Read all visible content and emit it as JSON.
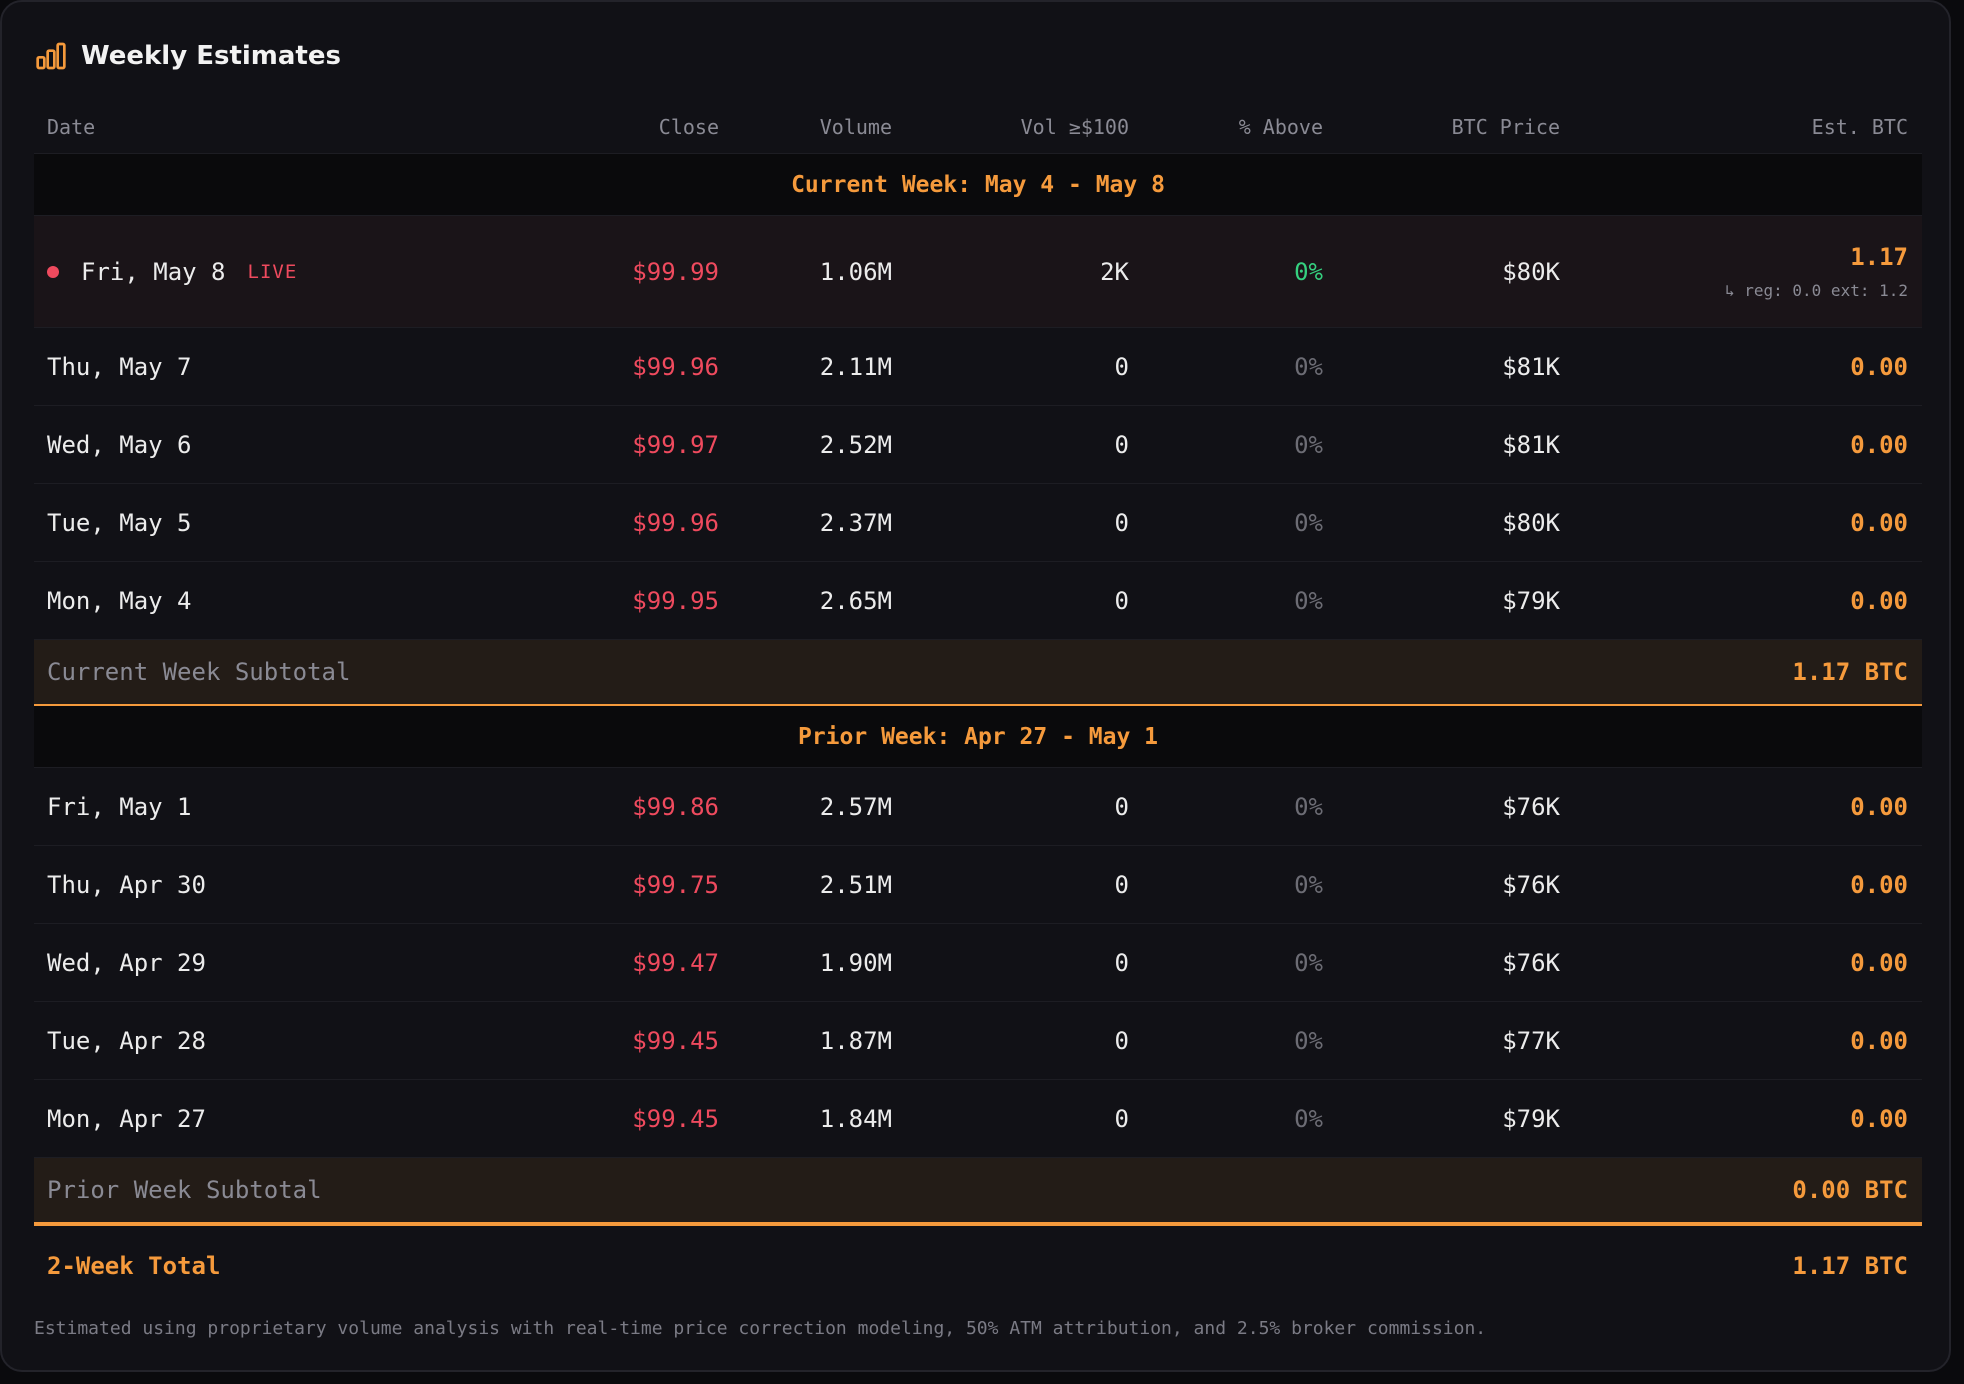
{
  "panel": {
    "title": "Weekly Estimates",
    "icon": "bar-chart-icon"
  },
  "columns": {
    "date": "Date",
    "close": "Close",
    "volume": "Volume",
    "vol100": "Vol ≥$100",
    "pct_above": "% Above",
    "btc_price": "BTC Price",
    "est_btc": "Est. BTC"
  },
  "current_week": {
    "heading": "Current Week: May 4 - May 8",
    "live": {
      "date": "Fri, May 8",
      "badge": "LIVE",
      "close": "$99.99",
      "volume": "1.06M",
      "vol100": "2K",
      "pct_above": "0%",
      "btc_price": "$80K",
      "est_btc": "1.17",
      "est_detail": "↳ reg: 0.0 ext: 1.2"
    },
    "rows": [
      {
        "date": "Thu, May 7",
        "close": "$99.96",
        "volume": "2.11M",
        "vol100": "0",
        "pct_above": "0%",
        "btc_price": "$81K",
        "est_btc": "0.00"
      },
      {
        "date": "Wed, May 6",
        "close": "$99.97",
        "volume": "2.52M",
        "vol100": "0",
        "pct_above": "0%",
        "btc_price": "$81K",
        "est_btc": "0.00"
      },
      {
        "date": "Tue, May 5",
        "close": "$99.96",
        "volume": "2.37M",
        "vol100": "0",
        "pct_above": "0%",
        "btc_price": "$80K",
        "est_btc": "0.00"
      },
      {
        "date": "Mon, May 4",
        "close": "$99.95",
        "volume": "2.65M",
        "vol100": "0",
        "pct_above": "0%",
        "btc_price": "$79K",
        "est_btc": "0.00"
      }
    ],
    "subtotal_label": "Current Week Subtotal",
    "subtotal_value": "1.17 BTC"
  },
  "prior_week": {
    "heading": "Prior Week: Apr 27 - May 1",
    "rows": [
      {
        "date": "Fri, May 1",
        "close": "$99.86",
        "volume": "2.57M",
        "vol100": "0",
        "pct_above": "0%",
        "btc_price": "$76K",
        "est_btc": "0.00"
      },
      {
        "date": "Thu, Apr 30",
        "close": "$99.75",
        "volume": "2.51M",
        "vol100": "0",
        "pct_above": "0%",
        "btc_price": "$76K",
        "est_btc": "0.00"
      },
      {
        "date": "Wed, Apr 29",
        "close": "$99.47",
        "volume": "1.90M",
        "vol100": "0",
        "pct_above": "0%",
        "btc_price": "$76K",
        "est_btc": "0.00"
      },
      {
        "date": "Tue, Apr 28",
        "close": "$99.45",
        "volume": "1.87M",
        "vol100": "0",
        "pct_above": "0%",
        "btc_price": "$77K",
        "est_btc": "0.00"
      },
      {
        "date": "Mon, Apr 27",
        "close": "$99.45",
        "volume": "1.84M",
        "vol100": "0",
        "pct_above": "0%",
        "btc_price": "$79K",
        "est_btc": "0.00"
      }
    ],
    "subtotal_label": "Prior Week Subtotal",
    "subtotal_value": "0.00 BTC"
  },
  "total": {
    "label": "2-Week Total",
    "value": "1.17 BTC"
  },
  "footnote": "Estimated using proprietary volume analysis with real-time price correction modeling, 50% ATM attribution, and 2.5% broker commission.",
  "colors": {
    "accent": "#f59a3c",
    "negative": "#ef4a5e",
    "positive": "#35d07f",
    "background": "#111116"
  }
}
